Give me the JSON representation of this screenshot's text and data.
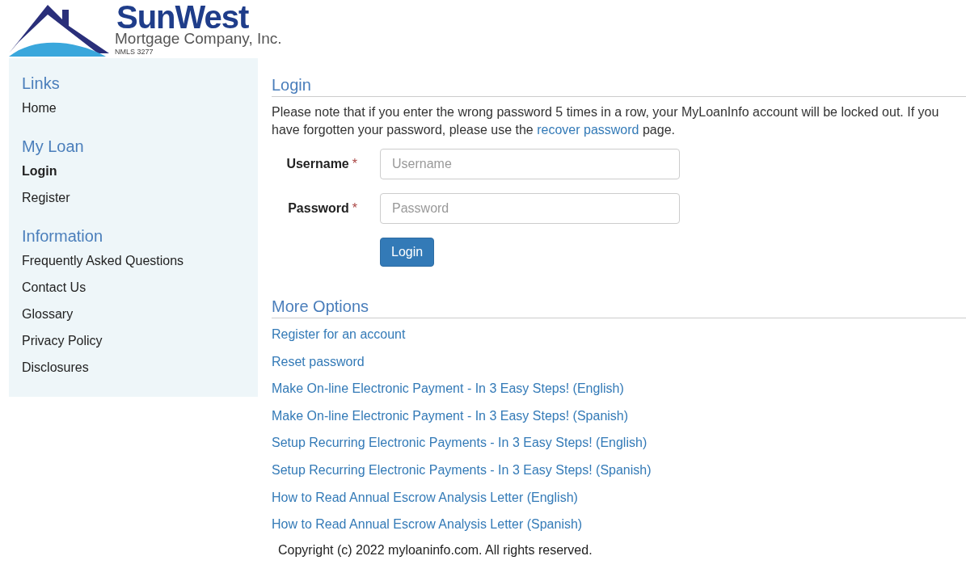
{
  "logo": {
    "brand": "SunWest",
    "company": "Mortgage Company, Inc.",
    "license": "NMLS 3277"
  },
  "sidebar": {
    "sections": [
      {
        "heading": "Links",
        "items": [
          {
            "label": "Home",
            "selected": false
          }
        ]
      },
      {
        "heading": "My Loan",
        "items": [
          {
            "label": "Login",
            "selected": true
          },
          {
            "label": "Register",
            "selected": false
          }
        ]
      },
      {
        "heading": "Information",
        "items": [
          {
            "label": "Frequently Asked Questions",
            "selected": false
          },
          {
            "label": "Contact Us",
            "selected": false
          },
          {
            "label": "Glossary",
            "selected": false
          },
          {
            "label": "Privacy Policy",
            "selected": false
          },
          {
            "label": "Disclosures",
            "selected": false
          }
        ]
      }
    ]
  },
  "login": {
    "heading": "Login",
    "notice_before": "Please note that if you enter the wrong password 5 times in a row, your MyLoanInfo account will be locked out. If you have forgotten your password, please use the ",
    "notice_link": "recover password",
    "notice_after": " page.",
    "fields": [
      {
        "label": "Username",
        "required_mark": "*",
        "placeholder": "Username"
      },
      {
        "label": "Password",
        "required_mark": "*",
        "placeholder": "Password"
      }
    ],
    "button": "Login"
  },
  "more_options": {
    "heading": "More Options",
    "links": [
      "Register for an account",
      "Reset password",
      "Make On-line Electronic Payment - In 3 Easy Steps! (English)",
      "Make On-line Electronic Payment - In 3 Easy Steps! (Spanish)",
      "Setup Recurring Electronic Payments - In 3 Easy Steps! (English)",
      "Setup Recurring Electronic Payments - In 3 Easy Steps! (Spanish)",
      "How to Read Annual Escrow Analysis Letter (English)",
      "How to Read Annual Escrow Analysis Letter (Spanish)"
    ]
  },
  "footer": "Copyright (c) 2022 myloaninfo.com. All rights reserved."
}
